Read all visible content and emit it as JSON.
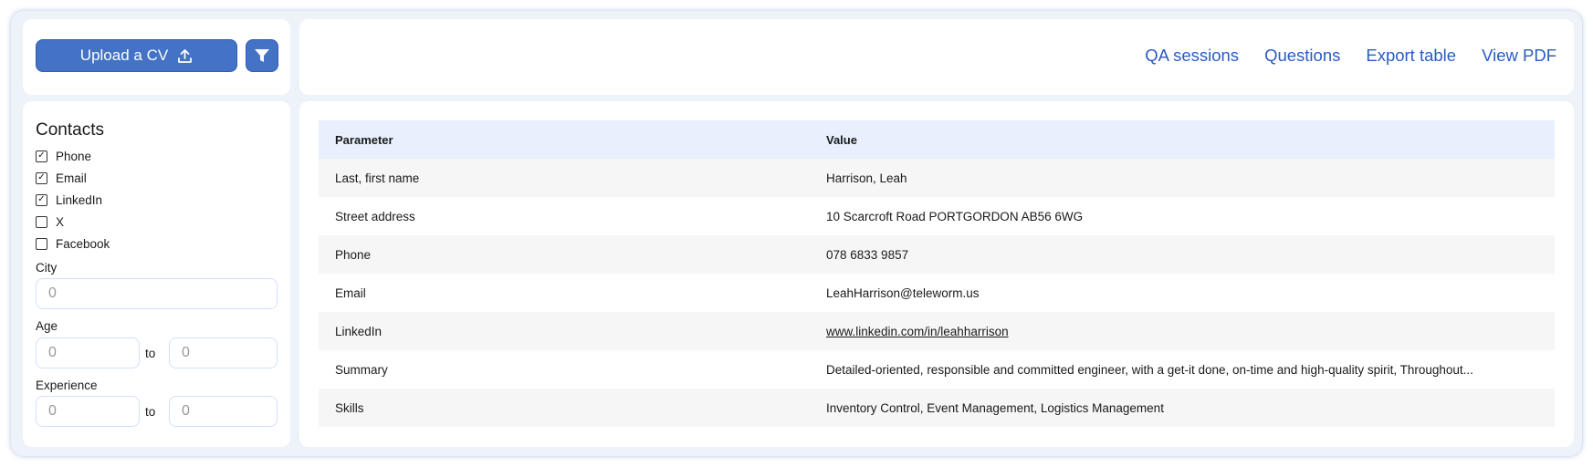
{
  "sidebar": {
    "upload_label": "Upload a CV",
    "contacts_heading": "Contacts",
    "contacts": [
      {
        "label": "Phone",
        "checked": true
      },
      {
        "label": "Email",
        "checked": true
      },
      {
        "label": "LinkedIn",
        "checked": true
      },
      {
        "label": "X",
        "checked": false
      },
      {
        "label": "Facebook",
        "checked": false
      }
    ],
    "city_label": "City",
    "city_placeholder": "0",
    "age_label": "Age",
    "age_from": "0",
    "age_to": "0",
    "experience_label": "Experience",
    "exp_from": "0",
    "exp_to": "0",
    "to_label": "to"
  },
  "header": {
    "links": [
      "QA sessions",
      "Questions",
      "Export table",
      "View PDF"
    ]
  },
  "table": {
    "headers": [
      "Parameter",
      "Value"
    ],
    "rows": [
      [
        "Last, first name",
        "Harrison, Leah"
      ],
      [
        "Street address",
        "10 Scarcroft Road PORTGORDON AB56 6WG"
      ],
      [
        "Phone",
        "078 6833 9857"
      ],
      [
        "Email",
        "LeahHarrison@teleworm.us"
      ],
      [
        "LinkedIn",
        "www.linkedin.com/in/leahharrison"
      ],
      [
        "Summary",
        "Detailed-oriented, responsible and committed engineer, with a get-it done, on-time and high-quality spirit, Throughout..."
      ],
      [
        "Skills",
        "Inventory Control, Event Management, Logistics Management"
      ]
    ]
  },
  "colors": {
    "accent": "#4472c4",
    "link": "#2a5bc4",
    "table_header": "#e8f0fe",
    "stripe": "#f6f6f6"
  }
}
